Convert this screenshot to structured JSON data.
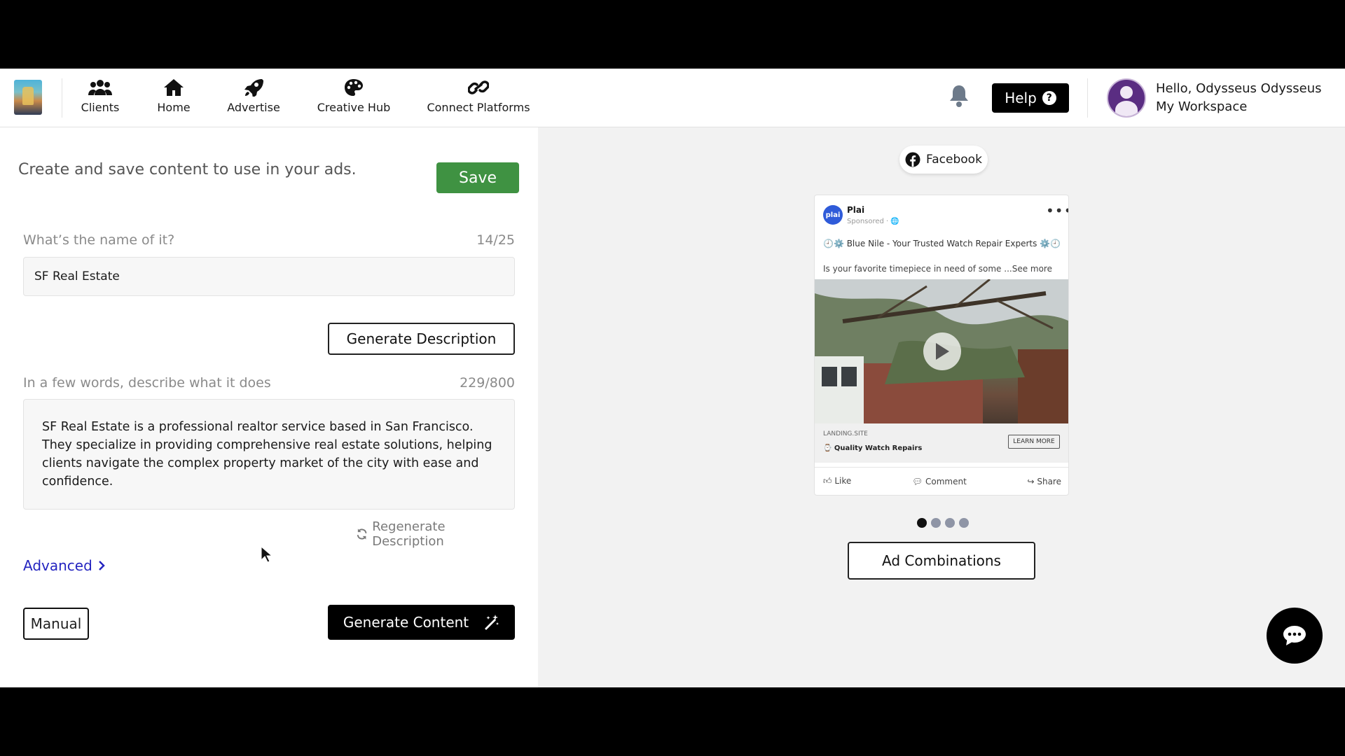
{
  "nav": {
    "items": [
      {
        "label": "Clients",
        "icon": "users-icon"
      },
      {
        "label": "Home",
        "icon": "home-icon"
      },
      {
        "label": "Advertise",
        "icon": "rocket-icon"
      },
      {
        "label": "Creative Hub",
        "icon": "palette-icon"
      },
      {
        "label": "Connect Platforms",
        "icon": "link-icon"
      }
    ],
    "help_label": "Help",
    "help_glyph": "?",
    "greeting": "Hello, Odysseus Odysseus",
    "workspace": "My Workspace"
  },
  "form": {
    "intro": "Create and save content to use in your ads.",
    "save_label": "Save",
    "name_label": "What’s the name of it?",
    "name_counter": "14/25",
    "name_value": "SF Real Estate",
    "generate_description_label": "Generate Description",
    "desc_label": "In a few words, describe what it does",
    "desc_counter": "229/800",
    "desc_value": "SF Real Estate is a professional realtor service based in San Francisco. They specialize in providing comprehensive real estate solutions, helping clients navigate the complex property market of the city with ease and confidence.",
    "regenerate_label": "Regenerate Description",
    "advanced_label": "Advanced",
    "manual_label": "Manual",
    "generate_content_label": "Generate Content"
  },
  "preview": {
    "platform_label": "Facebook",
    "card": {
      "avatar_text": "plai",
      "page_name": "Plai",
      "sponsored": "Sponsored · 🌐",
      "headline": "🕘⚙️ Blue Nile - Your Trusted Watch Repair Experts ⚙️🕘",
      "body": "Is your favorite timepiece in need of some ...See more",
      "site": "LANDING.SITE",
      "cta_title": "⌚ Quality Watch Repairs",
      "cta_label": "LEARN MORE",
      "like": "Like",
      "comment": "Comment",
      "share": "Share"
    },
    "carousel": {
      "count": 4,
      "active_index": 0
    },
    "ad_combinations_label": "Ad Combinations"
  },
  "colors": {
    "save_green": "#3f9242",
    "link_blue": "#2424c0",
    "panel_gray": "#f2f2f2"
  }
}
